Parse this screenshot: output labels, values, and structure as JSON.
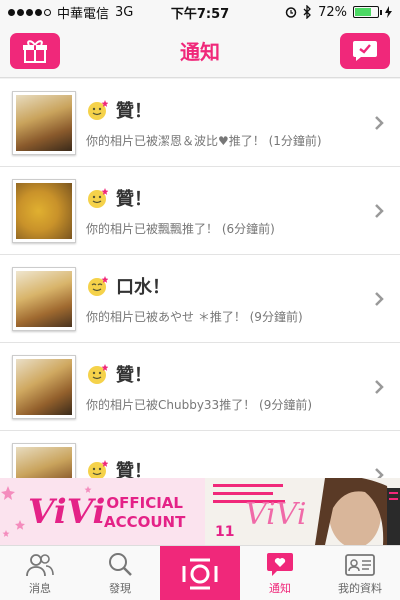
{
  "status_bar": {
    "carrier": "中華電信",
    "network": "3G",
    "time": "下午7:57",
    "battery": "72%",
    "battery_level": 0.72
  },
  "header": {
    "title": "通知",
    "left_icon": "gift-icon",
    "right_icon": "chat-check-icon",
    "accent_color": "#f0287a"
  },
  "notifications": [
    {
      "title": "贊！",
      "message": "你的相片已被潔恩＆波比♥推了！ (1分鐘前)"
    },
    {
      "title": "贊！",
      "message": "你的相片已被飄飄推了！ (6分鐘前)"
    },
    {
      "title": "口水！",
      "message": "你的相片已被あやせ ＊推了！ (9分鐘前)"
    },
    {
      "title": "贊！",
      "message": "你的相片已被Chubby33推了！ (9分鐘前)"
    },
    {
      "title": "贊！",
      "message": ""
    }
  ],
  "ad": {
    "logo": "ViVi",
    "line1": "OFFICIAL",
    "line2": "ACCOUNT",
    "magazine_title": "ViVi",
    "magazine_issue": "11"
  },
  "tabs": [
    {
      "label": "消息",
      "icon": "people-icon"
    },
    {
      "label": "發現",
      "icon": "search-icon"
    },
    {
      "label": "",
      "icon": "camera-icon"
    },
    {
      "label": "通知",
      "icon": "heart-bubble-icon"
    },
    {
      "label": "我的資料",
      "icon": "profile-card-icon"
    }
  ]
}
